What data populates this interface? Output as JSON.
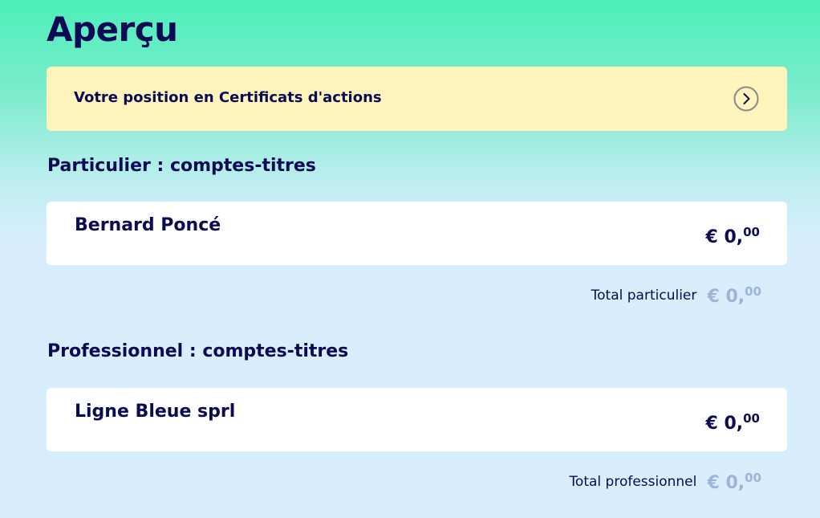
{
  "page": {
    "title": "Aperçu"
  },
  "certificates": {
    "label": "Votre position en Certificats d'actions",
    "icon": "chevron-right-icon"
  },
  "sections": [
    {
      "title": "Particulier : comptes-titres",
      "accounts": [
        {
          "name": "Bernard Poncé",
          "amount": {
            "currency": "€",
            "integer": "0,",
            "cents": "00"
          }
        }
      ],
      "total": {
        "label": "Total particulier",
        "amount": {
          "currency": "€",
          "integer": "0,",
          "cents": "00"
        }
      }
    },
    {
      "title": "Professionnel : comptes-titres",
      "accounts": [
        {
          "name": "Ligne Bleue sprl",
          "amount": {
            "currency": "€",
            "integer": "0,",
            "cents": "00"
          }
        }
      ],
      "total": {
        "label": "Total professionnel",
        "amount": {
          "currency": "€",
          "integer": "0,",
          "cents": "00"
        }
      }
    }
  ],
  "colors": {
    "primary_text": "#0b0a55",
    "banner_background": "#fef4bc",
    "total_amount": "#9fb3d6",
    "gradient_top": "#4cefb9",
    "gradient_bottom": "#d8eefc"
  }
}
